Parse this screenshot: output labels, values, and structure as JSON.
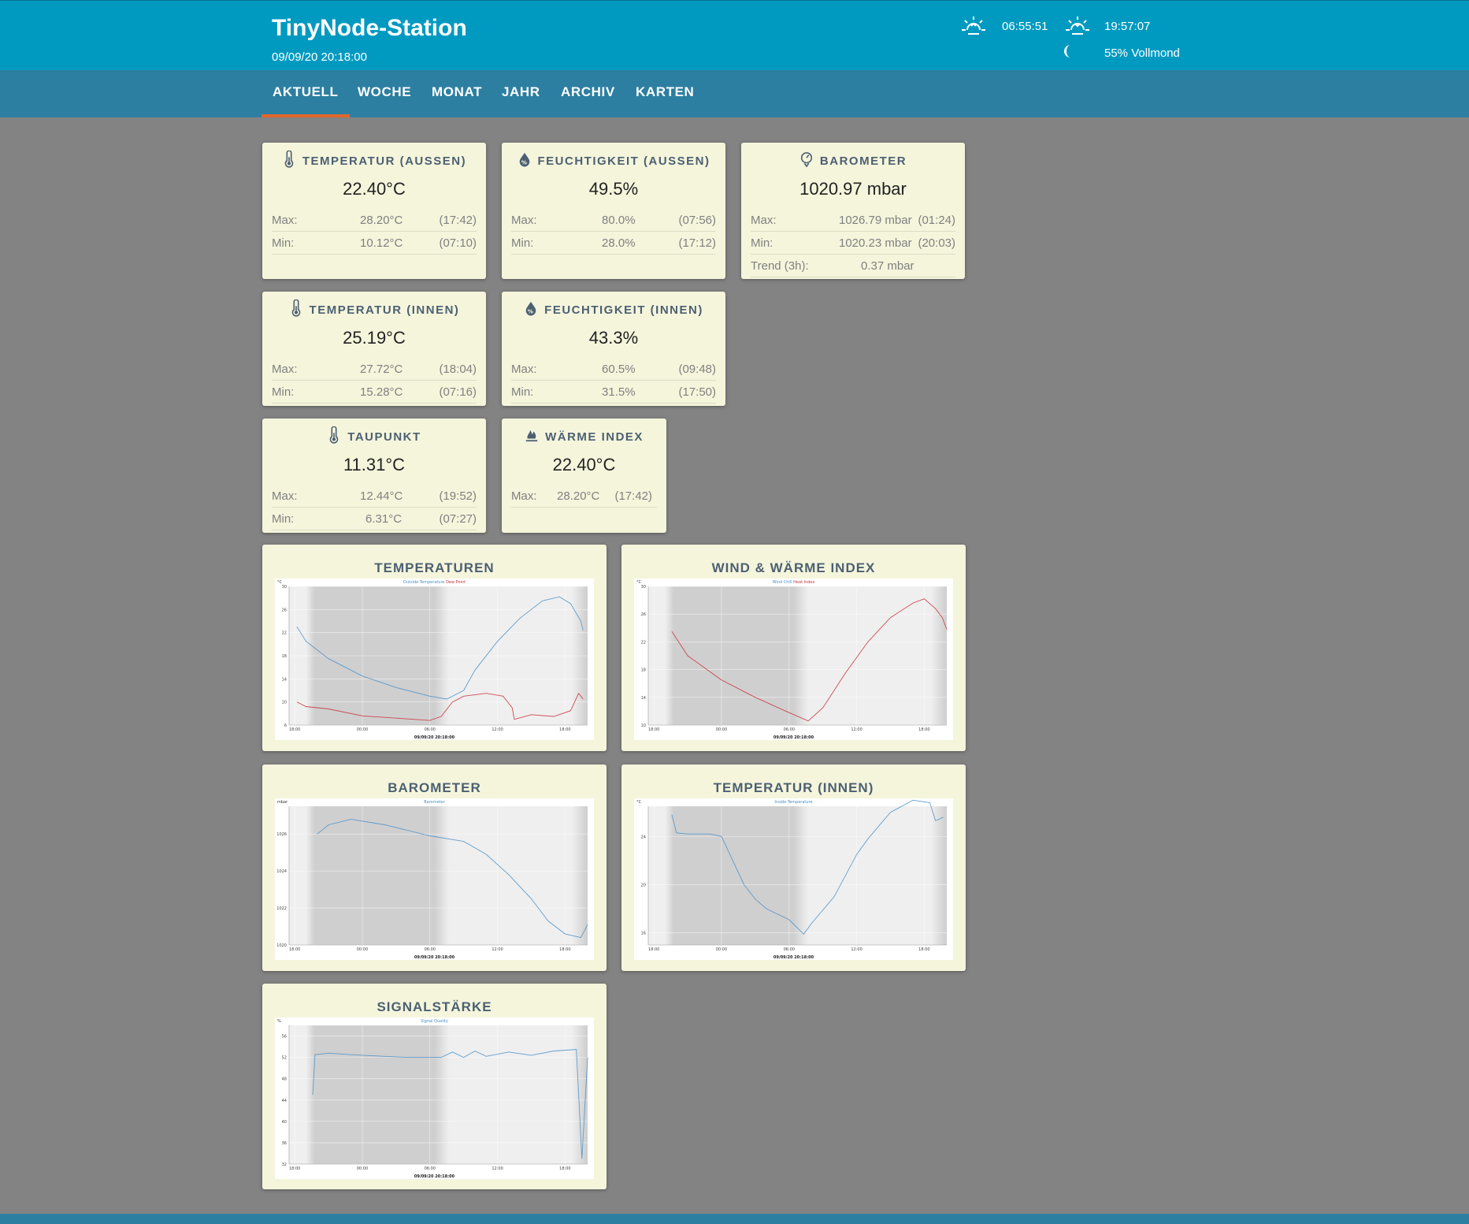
{
  "header": {
    "title": "TinyNode-Station",
    "date": "09/09/20 20:18:00",
    "sunrise": "06:55:51",
    "sunset": "19:57:07",
    "moon": "55% Vollmond"
  },
  "nav": [
    {
      "label": "AKTUELL",
      "active": true
    },
    {
      "label": "WOCHE"
    },
    {
      "label": "MONAT"
    },
    {
      "label": "JAHR"
    },
    {
      "label": "ARCHIV"
    },
    {
      "label": "KARTEN"
    }
  ],
  "cards": {
    "temp_out": {
      "title": "TEMPERATUR (AUSSEN)",
      "icon": "thermometer-icon",
      "value": "22.40°C",
      "rows": [
        {
          "label": "Max:",
          "value": "28.20°C",
          "time": "(17:42)"
        },
        {
          "label": "Min:",
          "value": "10.12°C",
          "time": "(07:10)"
        }
      ]
    },
    "hum_out": {
      "title": "FEUCHTIGKEIT (AUSSEN)",
      "icon": "humidity-icon",
      "value": "49.5%",
      "rows": [
        {
          "label": "Max:",
          "value": "80.0%",
          "time": "(07:56)"
        },
        {
          "label": "Min:",
          "value": "28.0%",
          "time": "(17:12)"
        }
      ]
    },
    "baro": {
      "title": "BAROMETER",
      "icon": "barometer-icon",
      "value": "1020.97 mbar",
      "rows": [
        {
          "label": "Max:",
          "value": "1026.79 mbar",
          "time": "(01:24)"
        },
        {
          "label": "Min:",
          "value": "1020.23 mbar",
          "time": "(20:03)"
        },
        {
          "label": "Trend (3h):",
          "value": "0.37 mbar",
          "time": ""
        }
      ]
    },
    "temp_in": {
      "title": "TEMPERATUR (INNEN)",
      "icon": "thermometer-icon",
      "value": "25.19°C",
      "rows": [
        {
          "label": "Max:",
          "value": "27.72°C",
          "time": "(18:04)"
        },
        {
          "label": "Min:",
          "value": "15.28°C",
          "time": "(07:16)"
        }
      ]
    },
    "hum_in": {
      "title": "FEUCHTIGKEIT (INNEN)",
      "icon": "humidity-icon",
      "value": "43.3%",
      "rows": [
        {
          "label": "Max:",
          "value": "60.5%",
          "time": "(09:48)"
        },
        {
          "label": "Min:",
          "value": "31.5%",
          "time": "(17:50)"
        }
      ]
    },
    "dew": {
      "title": "TAUPUNKT",
      "icon": "thermometer-icon",
      "value": "11.31°C",
      "rows": [
        {
          "label": "Max:",
          "value": "12.44°C",
          "time": "(19:52)"
        },
        {
          "label": "Min:",
          "value": "6.31°C",
          "time": "(07:27)"
        }
      ]
    },
    "heat": {
      "title": "WÄRME INDEX",
      "icon": "fire-icon",
      "value": "22.40°C",
      "rows": [
        {
          "label": "Max:",
          "value": "28.20°C",
          "time": "(17:42)"
        }
      ]
    }
  },
  "charts": {
    "temperatures": {
      "title": "TEMPERATUREN",
      "legend": [
        {
          "label": "Outside Temperature",
          "color": "#4a90c8"
        },
        {
          "label": "Dew Point",
          "color": "#c8303a"
        }
      ],
      "unit": "°C"
    },
    "wind_heat": {
      "title": "WIND & WÄRME INDEX",
      "legend": [
        {
          "label": "Wind Chill",
          "color": "#4a90c8"
        },
        {
          "label": "Heat Index",
          "color": "#c8303a"
        }
      ],
      "unit": "°C"
    },
    "barometer": {
      "title": "BAROMETER",
      "legend": [
        {
          "label": "Barometer",
          "color": "#4a90c8"
        }
      ],
      "unit": "mbar"
    },
    "temp_inside": {
      "title": "TEMPERATUR (INNEN)",
      "legend": [
        {
          "label": "Inside Temperature",
          "color": "#4a90c8"
        }
      ],
      "unit": "°C"
    },
    "signal": {
      "title": "SIGNALSTÄRKE",
      "legend": [
        {
          "label": "Signal Quality",
          "color": "#4a90c8"
        }
      ],
      "unit": "%"
    }
  },
  "chart_data": [
    {
      "type": "line",
      "title": "",
      "xlabel": "09/09/20 20:18:00",
      "ylabel": "°C",
      "xticks": [
        "18:00",
        "00:00",
        "06:00",
        "12:00",
        "18:00"
      ],
      "x": [
        0,
        26
      ],
      "xlim": [
        -0.5,
        26
      ],
      "yticks": [
        "6",
        "10",
        "14",
        "18",
        "22",
        "26",
        "30"
      ],
      "ylim": [
        6,
        30
      ],
      "series": [
        {
          "name": "Outside Temperature",
          "points": [
            [
              0.2,
              23
            ],
            [
              1,
              20.5
            ],
            [
              3,
              17.5
            ],
            [
              6,
              14.5
            ],
            [
              9,
              12.5
            ],
            [
              12,
              11
            ],
            [
              13.5,
              10.5
            ],
            [
              15,
              12
            ],
            [
              16,
              15.5
            ],
            [
              18,
              20.5
            ],
            [
              20,
              24.5
            ],
            [
              22,
              27.5
            ],
            [
              23.5,
              28.2
            ],
            [
              24.5,
              27
            ],
            [
              25.4,
              24
            ],
            [
              25.6,
              22.4
            ]
          ]
        },
        {
          "name": "Dew Point",
          "points": [
            [
              0.2,
              10
            ],
            [
              1,
              9.2
            ],
            [
              3,
              8.8
            ],
            [
              6,
              7.6
            ],
            [
              9,
              7.2
            ],
            [
              12,
              6.8
            ],
            [
              13,
              7.5
            ],
            [
              14,
              10
            ],
            [
              15,
              11
            ],
            [
              17,
              11.5
            ],
            [
              18.5,
              11
            ],
            [
              19.3,
              9
            ],
            [
              19.5,
              7
            ],
            [
              21,
              7.8
            ],
            [
              23,
              7.5
            ],
            [
              24.5,
              8.5
            ],
            [
              25.2,
              11.5
            ],
            [
              25.6,
              10.5
            ]
          ]
        }
      ]
    },
    {
      "type": "line",
      "title": "",
      "xlabel": "09/09/20 20:18:00",
      "ylabel": "°C",
      "xticks": [
        "18:00",
        "00:00",
        "06:00",
        "12:00",
        "18:00"
      ],
      "xlim": [
        -0.5,
        26
      ],
      "yticks": [
        "10",
        "14",
        "18",
        "22",
        "26",
        "30"
      ],
      "ylim": [
        10,
        30
      ],
      "series": [
        {
          "name": "Wind Chill",
          "points": []
        },
        {
          "name": "Heat Index",
          "points": [
            [
              1.6,
              23.5
            ],
            [
              3,
              20
            ],
            [
              6,
              16.5
            ],
            [
              9,
              14
            ],
            [
              12,
              11.8
            ],
            [
              13.7,
              10.6
            ],
            [
              15,
              12.5
            ],
            [
              17,
              17.5
            ],
            [
              19,
              22
            ],
            [
              21,
              25.5
            ],
            [
              23,
              27.6
            ],
            [
              24,
              28.2
            ],
            [
              25,
              26.8
            ],
            [
              25.6,
              25.5
            ],
            [
              26,
              23.8
            ]
          ]
        }
      ]
    },
    {
      "type": "line",
      "title": "",
      "xlabel": "09/09/20 20:18:00",
      "ylabel": "mbar",
      "xticks": [
        "18:00",
        "00:00",
        "06:00",
        "12:00",
        "18:00"
      ],
      "xlim": [
        -0.5,
        26
      ],
      "yticks": [
        "1020",
        "1022",
        "1024",
        "1026"
      ],
      "ylim": [
        1020,
        1027.5
      ],
      "series": [
        {
          "name": "Barometer",
          "points": [
            [
              2,
              1026
            ],
            [
              3,
              1026.5
            ],
            [
              5,
              1026.8
            ],
            [
              8,
              1026.5
            ],
            [
              10,
              1026.2
            ],
            [
              12,
              1025.9
            ],
            [
              15,
              1025.6
            ],
            [
              17,
              1024.9
            ],
            [
              19,
              1023.8
            ],
            [
              21,
              1022.5
            ],
            [
              22.5,
              1021.3
            ],
            [
              24,
              1020.6
            ],
            [
              25.4,
              1020.4
            ],
            [
              26,
              1021.1
            ]
          ]
        }
      ]
    },
    {
      "type": "line",
      "title": "",
      "xlabel": "09/09/20 20:18:00",
      "ylabel": "°C",
      "xticks": [
        "18:00",
        "00:00",
        "06:00",
        "12:00",
        "18:00"
      ],
      "xlim": [
        -0.5,
        26
      ],
      "yticks": [
        "16",
        "20",
        "24"
      ],
      "ylim": [
        15,
        26.5
      ],
      "series": [
        {
          "name": "Inside Temperature",
          "points": [
            [
              1.6,
              25.8
            ],
            [
              2,
              24.3
            ],
            [
              3,
              24.2
            ],
            [
              5,
              24.2
            ],
            [
              6,
              24
            ],
            [
              7,
              22
            ],
            [
              8,
              20
            ],
            [
              9,
              18.8
            ],
            [
              10,
              18
            ],
            [
              12,
              17.1
            ],
            [
              13.3,
              15.9
            ],
            [
              14,
              16.8
            ],
            [
              16,
              19
            ],
            [
              18,
              22.5
            ],
            [
              19,
              23.8
            ],
            [
              21,
              26
            ],
            [
              23,
              27
            ],
            [
              24.5,
              26.8
            ],
            [
              25,
              25.3
            ],
            [
              25.7,
              25.6
            ]
          ]
        }
      ]
    },
    {
      "type": "line",
      "title": "",
      "xlabel": "09/09/20 20:18:00",
      "ylabel": "%",
      "xticks": [
        "18:00",
        "00:00",
        "06:00",
        "12:00",
        "18:00"
      ],
      "xlim": [
        -0.5,
        26
      ],
      "yticks": [
        "32",
        "36",
        "40",
        "44",
        "48",
        "52",
        "56"
      ],
      "ylim": [
        32,
        58
      ],
      "series": [
        {
          "name": "Signal Quality",
          "points": [
            [
              1.6,
              45
            ],
            [
              1.8,
              52.5
            ],
            [
              3,
              52.8
            ],
            [
              5,
              52.5
            ],
            [
              8,
              52.2
            ],
            [
              10,
              52
            ],
            [
              13,
              52
            ],
            [
              14,
              53
            ],
            [
              15,
              52
            ],
            [
              16,
              53.2
            ],
            [
              17,
              52.2
            ],
            [
              19,
              53
            ],
            [
              21,
              52.4
            ],
            [
              23,
              53.2
            ],
            [
              25,
              53.5
            ],
            [
              25.5,
              33
            ],
            [
              26,
              52
            ]
          ]
        }
      ]
    }
  ]
}
